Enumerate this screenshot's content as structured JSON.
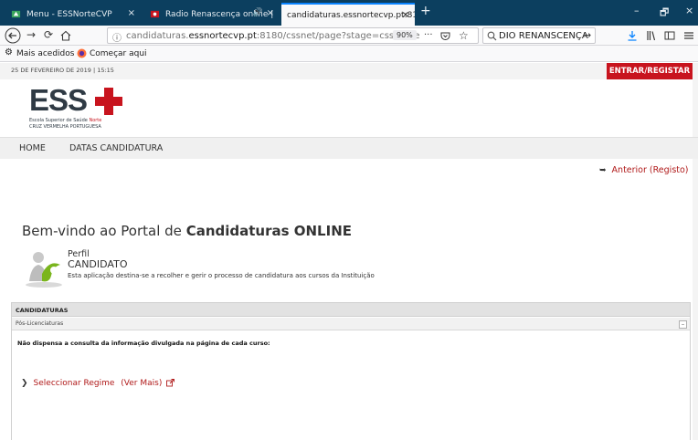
{
  "browser": {
    "tabs": [
      {
        "title": "Menu - ESSNorteCVP",
        "close": "×"
      },
      {
        "title": "Radio Renascença online |",
        "audio": "🔊",
        "close": "×"
      },
      {
        "title": "candidaturas.essnortecvp.pt:8180/",
        "close": "×"
      }
    ],
    "new_tab": "+",
    "window_controls": [
      "–",
      "🗗",
      "×"
    ],
    "url": {
      "prefix": "candidaturas.",
      "domain": "essnortecvp.pt",
      "rest": ":8180/cssnet/page?stage=csshome"
    },
    "zoom": "90%",
    "search_text": "DIO RENANSCENÇA",
    "bookmarks": [
      "Mais acedidos",
      "Começar aqui"
    ]
  },
  "site": {
    "date": "25 DE FEVEREIRO DE 2019 | 15:15",
    "login_label": "ENTRAR/REGISTAR",
    "logo": {
      "letters": "ESS",
      "line1_prefix": "Escola Superior de Saúde",
      "line1_accent": "Norte",
      "line2": "CRUZ VERMELHA PORTUGUESA",
      "accent_color": "#c8141e",
      "text_color": "#2f3a44"
    },
    "menu": [
      "HOME",
      "DATAS CANDIDATURA"
    ],
    "prev_link": "Anterior (Registo)"
  },
  "main": {
    "welcome_prefix": "Bem-vindo ao Portal de ",
    "welcome_bold": "Candidaturas ONLINE",
    "profile_title": "Perfil",
    "profile_role": "CANDIDATO",
    "profile_desc": "Esta aplicação destina-se a recolher e gerir o processo de candidatura aos cursos da Instituição"
  },
  "panel": {
    "header": "CANDIDATURAS",
    "sub": "Pós-Licenciaturas",
    "collapse": "–",
    "notice": "Não dispensa a consulta da informação divulgada na página de cada curso:",
    "regime": "Seleccionar Regime",
    "more": "(Ver Mais)"
  }
}
